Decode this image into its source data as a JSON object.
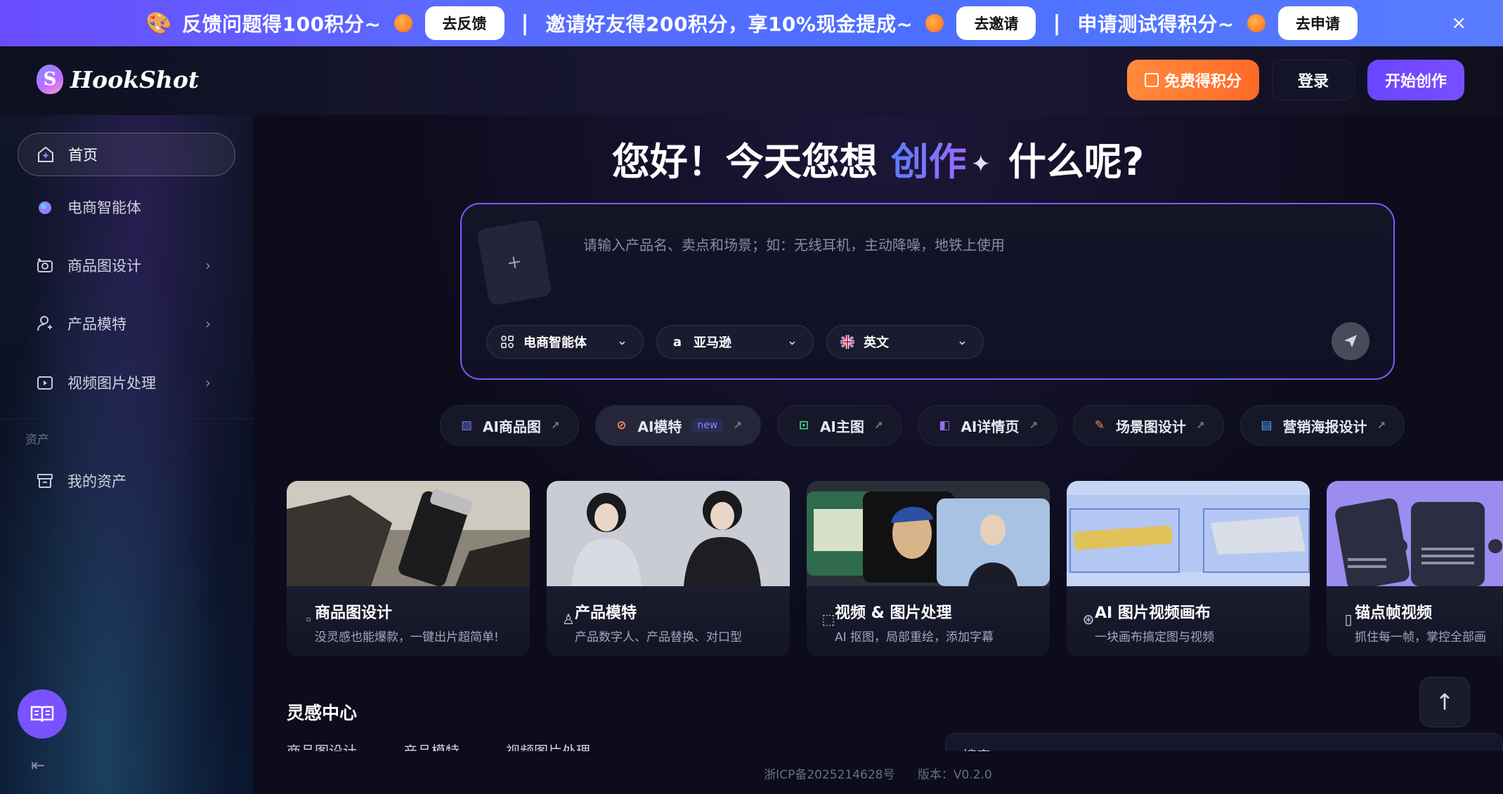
{
  "banner": {
    "items": [
      {
        "text": "反馈问题得100积分~",
        "button": "去反馈"
      },
      {
        "text": "邀请好友得200积分，享10%现金提成~",
        "button": "去邀请"
      },
      {
        "text": "申请测试得积分~",
        "button": "去申请"
      }
    ],
    "separator": "|",
    "close": "×"
  },
  "header": {
    "logo_text": "HookShot",
    "logo_letter": "S",
    "free_points": "免费得积分",
    "login": "登录",
    "start": "开始创作"
  },
  "sidebar": {
    "items": [
      {
        "label": "首页",
        "icon": "home-icon"
      },
      {
        "label": "电商智能体",
        "icon": "agent-icon"
      },
      {
        "label": "商品图设计",
        "icon": "camera-icon"
      },
      {
        "label": "产品模特",
        "icon": "person-icon"
      },
      {
        "label": "视频图片处理",
        "icon": "video-icon"
      }
    ],
    "section_label": "资产",
    "assets": {
      "label": "我的资产",
      "icon": "archive-icon"
    }
  },
  "hero": {
    "prefix": "您好！今天您想",
    "highlight": "创作",
    "suffix": "什么呢?"
  },
  "prompt": {
    "placeholder": "请输入产品名、卖点和场景；如：无线耳机，主动降噪，地铁上使用",
    "selects": [
      {
        "label": "电商智能体",
        "icon": "grid-icon"
      },
      {
        "label": "亚马逊",
        "icon": "amazon-icon"
      },
      {
        "label": "英文",
        "icon": "uk-flag-icon"
      }
    ]
  },
  "tools": [
    {
      "label": "AI商品图",
      "color": "#6f7bff",
      "badge": ""
    },
    {
      "label": "AI模特",
      "color": "#ff8a5a",
      "badge": "new"
    },
    {
      "label": "AI主图",
      "color": "#3fd08a",
      "badge": ""
    },
    {
      "label": "AI详情页",
      "color": "#9a6bff",
      "badge": ""
    },
    {
      "label": "场景图设计",
      "color": "#ff8a5a",
      "badge": ""
    },
    {
      "label": "营销海报设计",
      "color": "#4aa8ff",
      "badge": ""
    }
  ],
  "cards": [
    {
      "title": "商品图设计",
      "sub": "没灵感也能爆款，一键出片超简单!"
    },
    {
      "title": "产品模特",
      "sub": "产品数字人、产品替换、对口型"
    },
    {
      "title": "视频 & 图片处理",
      "sub": "AI 抠图，局部重绘，添加字幕"
    },
    {
      "title": "AI 图片视频画布",
      "sub": "一块画布搞定图与视频"
    },
    {
      "title": "锚点帧视频",
      "sub": "抓住每一帧，掌控全部画"
    }
  ],
  "inspire": {
    "title": "灵感中心",
    "tabs": [
      "商品图设计",
      "产品模特",
      "视频图片处理"
    ],
    "search_placeholder": "搜索"
  },
  "footer": {
    "icp": "浙ICP备2025214628号",
    "version_label": "版本：",
    "version": "V0.2.0"
  }
}
